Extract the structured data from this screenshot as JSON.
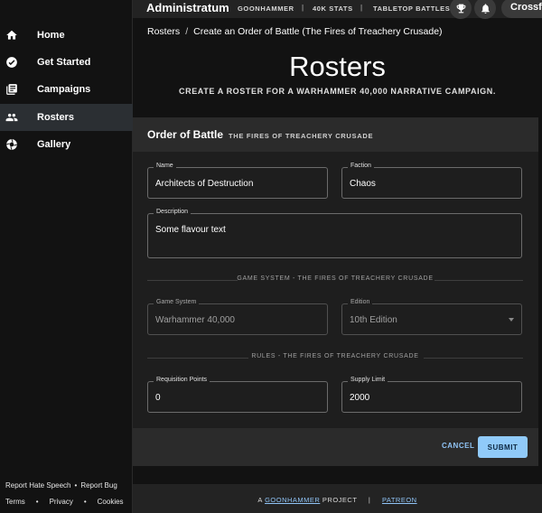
{
  "sidebar": {
    "items": [
      {
        "label": "Home",
        "icon": "home-icon"
      },
      {
        "label": "Get Started",
        "icon": "check-circle-icon"
      },
      {
        "label": "Campaigns",
        "icon": "library-icon"
      },
      {
        "label": "Rosters",
        "icon": "group-icon",
        "active": true
      },
      {
        "label": "Gallery",
        "icon": "aperture-icon"
      }
    ],
    "footer": {
      "report_hate": "Report Hate Speech",
      "report_bug": "Report Bug",
      "terms": "Terms",
      "privacy": "Privacy",
      "cookies": "Cookies"
    }
  },
  "topbar": {
    "title": "Administratum",
    "links": [
      "GOONHAMMER",
      "40K STATS",
      "TABLETOP BATTLES"
    ],
    "separator": "|",
    "user": "Crossfire"
  },
  "breadcrumb": {
    "root": "Rosters",
    "sep": "/",
    "current": "Create an Order of Battle (The Fires of Treachery Crusade)"
  },
  "header": {
    "title": "Rosters",
    "subtitle": "CREATE A ROSTER FOR A WARHAMMER 40,000 NARRATIVE CAMPAIGN."
  },
  "form": {
    "title": "Order of Battle",
    "subtitle": "THE FIRES OF TREACHERY CRUSADE",
    "name": {
      "label": "Name",
      "value": "Architects of Destruction"
    },
    "faction": {
      "label": "Faction",
      "value": "Chaos"
    },
    "description": {
      "label": "Description",
      "value": "Some flavour text"
    },
    "game_system_divider": "GAME SYSTEM - THE FIRES OF TREACHERY CRUSADE",
    "game_system": {
      "label": "Game System",
      "value": "Warhammer 40,000"
    },
    "edition": {
      "label": "Edition",
      "value": "10th Edition"
    },
    "rules_divider": "RULES - THE FIRES OF TREACHERY CRUSADE",
    "requisition": {
      "label": "Requisition Points",
      "value": "0"
    },
    "supply": {
      "label": "Supply Limit",
      "value": "2000"
    },
    "cancel_label": "CANCEL",
    "submit_label": "SUBMIT"
  },
  "footer": {
    "prefix": "A",
    "goonhammer": "GOONHAMMER",
    "project": "PROJECT",
    "pipe": "|",
    "patreon": "PATREON"
  },
  "colors": {
    "background": "#121212",
    "surface": "#1e1e1e",
    "accent": "#90caf9"
  }
}
